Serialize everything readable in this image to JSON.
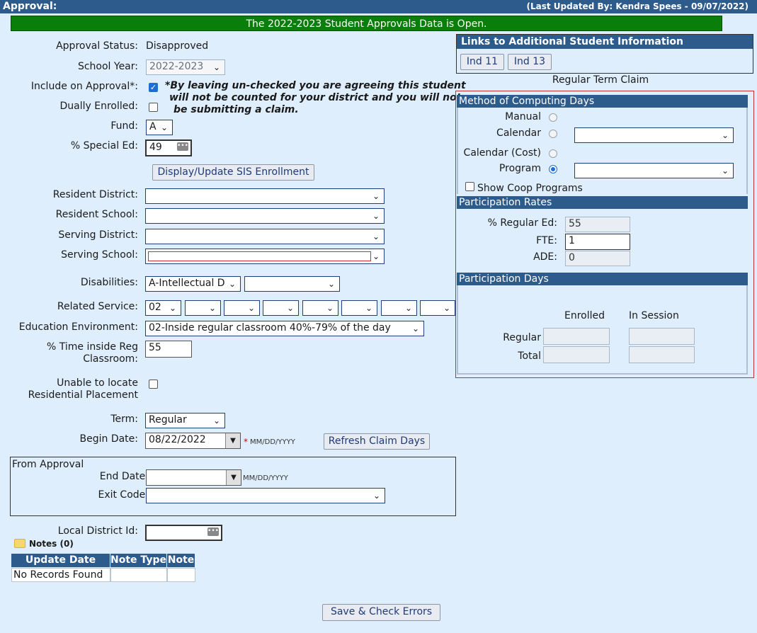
{
  "header": {
    "title": "Approval:",
    "last_updated": "(Last Updated By: Kendra Spees - 09/07/2022)"
  },
  "banner": "The 2022-2023 Student Approvals Data is Open.",
  "form": {
    "approval_status_label": "Approval Status:",
    "approval_status_value": "Disapproved",
    "school_year_label": "School Year:",
    "school_year_value": "2022-2023",
    "include_label": "Include on Approval*:",
    "include_checked": true,
    "include_note_line1": "*By leaving un-checked you are agreeing this student",
    "include_note_line2": "will not be counted for your district and you will not",
    "include_note_line3": "be submitting a claim.",
    "dually_label": "Dually Enrolled:",
    "dually_checked": false,
    "fund_label": "Fund:",
    "fund_value": "A",
    "special_ed_label": "% Special Ed:",
    "special_ed_value": "49",
    "display_sis_button": "Display/Update SIS Enrollment",
    "resident_district_label": "Resident District:",
    "resident_school_label": "Resident School:",
    "serving_district_label": "Serving District:",
    "serving_school_label": "Serving School:",
    "disabilities_label": "Disabilities:",
    "disability1_value": "A-Intellectual D",
    "disability2_value": "",
    "related_service_label": "Related Service:",
    "related_service_values": [
      "02",
      "",
      "",
      "",
      "",
      "",
      "",
      ""
    ],
    "edu_env_label": "Education Environment:",
    "edu_env_value": "02-Inside regular classroom 40%-79% of the day",
    "time_inside_label_1": "% Time inside Reg",
    "time_inside_label_2": "Classroom:",
    "time_inside_value": "55",
    "unable_label_1": "Unable to locate",
    "unable_label_2": "Residential Placement",
    "unable_checked": false,
    "term_label": "Term:",
    "term_value": "Regular",
    "begin_date_label": "Begin Date:",
    "begin_date_value": "08/22/2022",
    "begin_required": "*",
    "date_hint": "MM/DD/YYYY",
    "refresh_button": "Refresh Claim Days",
    "from_approval_label": "From Approval",
    "end_date_label": "End Date:",
    "end_date_value": "",
    "exit_code_label": "Exit Code:",
    "exit_code_value": "",
    "local_id_label": "Local District Id:",
    "local_id_value": "",
    "notes_label": "Notes (0)",
    "notes_table": {
      "headers": [
        "Update Date",
        "Note Type",
        "Note"
      ],
      "empty_text": "No Records Found"
    },
    "save_button": "Save & Check Errors"
  },
  "right": {
    "links_title": "Links to Additional Student Information",
    "links": [
      "Ind 11",
      "Ind 13"
    ],
    "claim_title": "Regular Term Claim",
    "method_header": "Method of Computing Days",
    "methods": [
      {
        "label": "Manual",
        "selected": false
      },
      {
        "label": "Calendar",
        "selected": false
      },
      {
        "label": "Calendar (Cost)",
        "selected": false
      },
      {
        "label": "Program",
        "selected": true
      }
    ],
    "show_coop_label": "Show Coop Programs",
    "rates_header": "Participation Rates",
    "regular_ed_label": "% Regular Ed:",
    "regular_ed_value": "55",
    "fte_label": "FTE:",
    "fte_value": "1",
    "ade_label": "ADE:",
    "ade_value": "0",
    "days_header": "Participation Days",
    "enrolled_label": "Enrolled",
    "in_session_label": "In Session",
    "regular_label": "Regular",
    "total_label": "Total"
  },
  "colors": {
    "header_blue": "#2d5b8c",
    "banner_green": "#0a7e0a",
    "page_bg": "#dfeefc",
    "panel_border": "#c23030"
  }
}
